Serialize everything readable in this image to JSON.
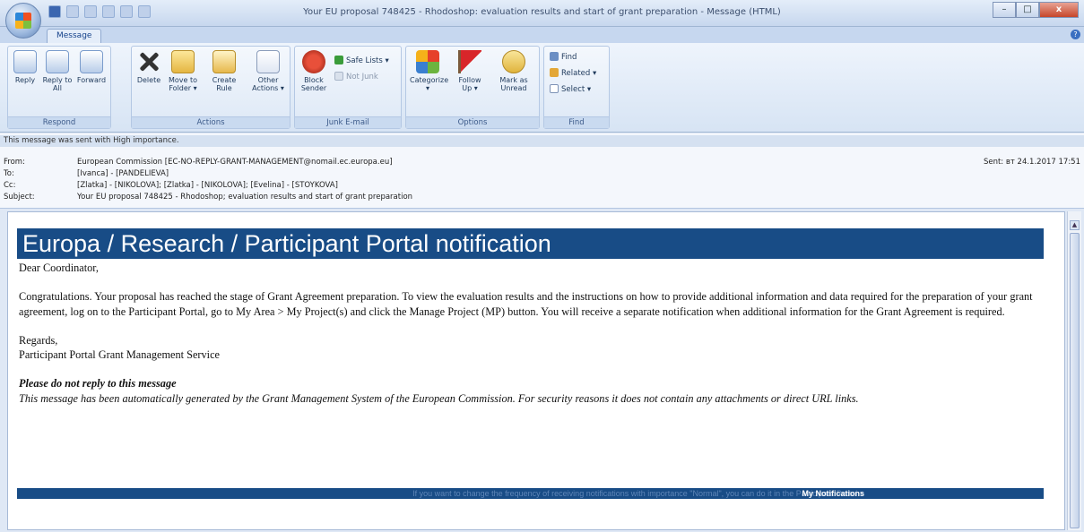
{
  "window": {
    "title": "Your EU proposal 748425 - Rhodoshop: evaluation results and start of grant preparation - Message (HTML)",
    "minimize": "–",
    "maximize": "□",
    "close": "x"
  },
  "tabs": [
    {
      "label": "Message"
    }
  ],
  "ribbon": {
    "respond": {
      "label": "Respond",
      "reply": "Reply",
      "reply_all": "Reply to All",
      "forward": "Forward"
    },
    "actions": {
      "label": "Actions",
      "delete": "Delete",
      "move_to_folder": "Move to Folder ▾",
      "create_rule": "Create Rule",
      "other_actions": "Other Actions ▾"
    },
    "junk": {
      "label": "Junk E-mail",
      "block_sender": "Block Sender",
      "safe_lists": "Safe Lists ▾",
      "not_junk": "Not Junk"
    },
    "options": {
      "label": "Options",
      "categorize": "Categorize ▾",
      "follow_up": "Follow Up ▾",
      "mark_unread": "Mark as Unread"
    },
    "find": {
      "label": "Find",
      "find": "Find",
      "related": "Related ▾",
      "select": "Select ▾"
    }
  },
  "message": {
    "importance": "This message was sent with High importance.",
    "from_label": "From:",
    "from": "European Commission [EC-NO-REPLY-GRANT-MANAGEMENT@nomail.ec.europa.eu]",
    "to_label": "To:",
    "to": "[Ivanca] - [PANDELIEVA]",
    "cc_label": "Cc:",
    "cc": "[Zlatka] - [NIKOLOVA]; [Zlatka] - [NIKOLOVA]; [Evelina] - [STOYKOVA]",
    "subject_label": "Subject:",
    "subject": "Your EU proposal 748425 - Rhodoshop; evaluation results and start of grant preparation",
    "sent_label": "Sent:",
    "sent": "вт 24.1.2017 17:51"
  },
  "body": {
    "banner": "Europa / Research / Participant Portal notification",
    "greeting": "Dear Coordinator,",
    "paragraph": "Congratulations. Your proposal has reached the stage of Grant Agreement preparation. To view the evaluation results and the instructions on how to provide additional information and data required for the preparation of your grant agreement, log on to the Participant Portal, go to My Area > My Project(s) and click the Manage Project (MP) button. You will receive a separate notification when additional information for the Grant Agreement is required.",
    "regards": "Regards,",
    "signature": "Participant Portal Grant Management Service",
    "no_reply_title": "Please do not reply to this message",
    "no_reply_text": "This message has been automatically generated by the Grant Management System of the European Commission. For security reasons it does not contain any attachments or direct URL links.",
    "footer_text": "If you want to change the frequency of receiving notifications with importance \"Normal\", you can do it in the Participant Portal >",
    "footer_link": "My Notifications"
  }
}
